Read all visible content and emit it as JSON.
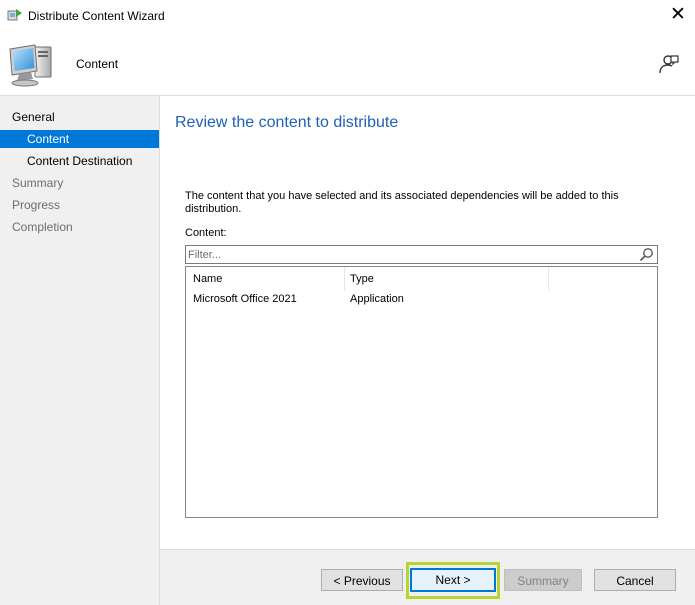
{
  "window": {
    "title": "Distribute Content Wizard",
    "close_glyph": "✕"
  },
  "header": {
    "title": "Content",
    "icon": "computer-monitor-icon",
    "help_icon": "user-help-icon"
  },
  "nav": {
    "items": [
      {
        "label": "General",
        "level": "group",
        "state": "normal"
      },
      {
        "label": "Content",
        "level": "sub",
        "state": "active"
      },
      {
        "label": "Content Destination",
        "level": "sub",
        "state": "normal"
      },
      {
        "label": "Summary",
        "level": "group",
        "state": "dim"
      },
      {
        "label": "Progress",
        "level": "group",
        "state": "dim"
      },
      {
        "label": "Completion",
        "level": "group",
        "state": "dim"
      }
    ]
  },
  "main": {
    "heading": "Review the content to distribute",
    "description": "The content that you have selected and its associated dependencies will be added to this distribution.",
    "content_label": "Content:",
    "filter_placeholder": "Filter...",
    "table": {
      "columns": [
        "Name",
        "Type"
      ],
      "rows": [
        {
          "name": "Microsoft Office 2021",
          "type": "Application"
        }
      ]
    }
  },
  "footer": {
    "previous": "< Previous",
    "next": "Next >",
    "summary": "Summary",
    "cancel": "Cancel"
  },
  "colors": {
    "accent": "#0078d7",
    "heading": "#1f5fb8",
    "highlight": "#b7d334"
  }
}
